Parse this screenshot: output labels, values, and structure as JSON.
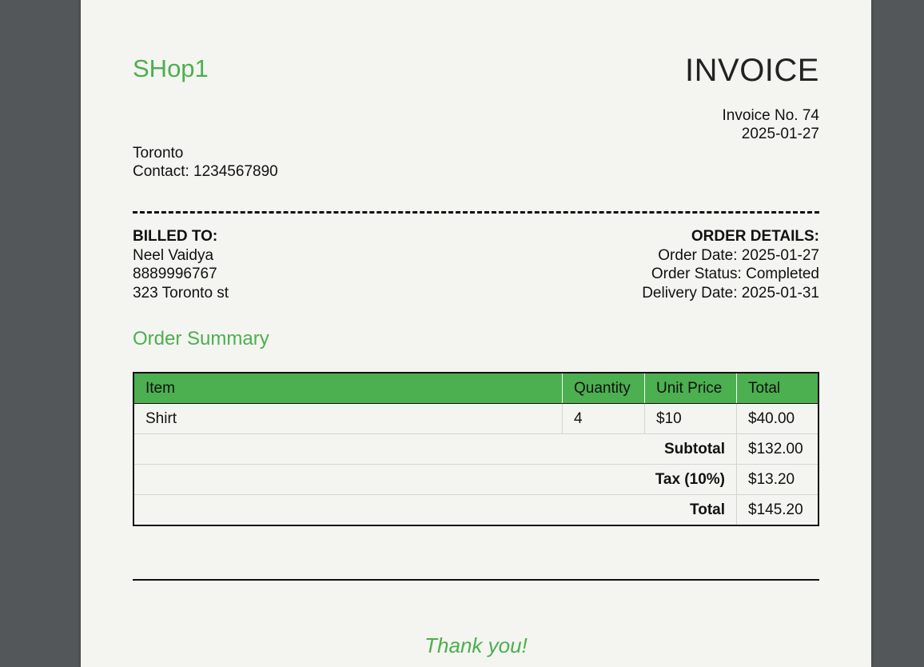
{
  "shop": {
    "name": "SHop1",
    "city": "Toronto",
    "contact": "Contact: 1234567890"
  },
  "invoice": {
    "title": "INVOICE",
    "number": "Invoice No. 74",
    "date": "2025-01-27"
  },
  "billed_to": {
    "heading": "BILLED TO:",
    "name": "Neel Vaidya",
    "phone": "8889996767",
    "address": "323 Toronto st"
  },
  "order_details": {
    "heading": "ORDER DETAILS:",
    "order_date": "Order Date: 2025-01-27",
    "status": "Order Status: Completed",
    "delivery_date": "Delivery Date: 2025-01-31"
  },
  "summary": {
    "title": "Order Summary",
    "headers": [
      "Item",
      "Quantity",
      "Unit Price",
      "Total"
    ],
    "rows": [
      {
        "item": "Shirt",
        "quantity": "4",
        "unit_price": "$10",
        "total": "$40.00"
      }
    ],
    "subtotal_label": "Subtotal",
    "subtotal": "$132.00",
    "tax_label": "Tax (10%)",
    "tax": "$13.20",
    "total_label": "Total",
    "total": "$145.20"
  },
  "footer": {
    "thanks": "Thank you!"
  },
  "colors": {
    "accent": "#4caf50",
    "page": "#f4f4f0",
    "viewer_bg": "#535759"
  }
}
